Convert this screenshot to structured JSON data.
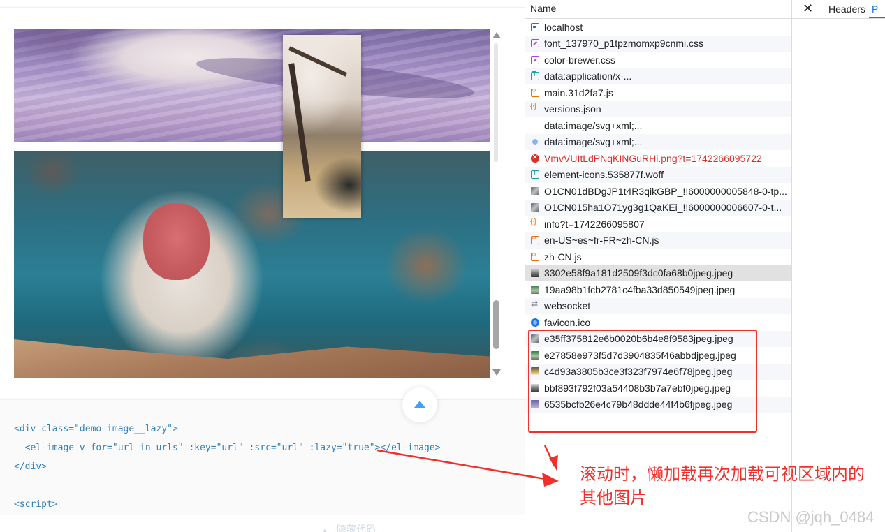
{
  "demo": {
    "code_lines": [
      "<div class=\"demo-image__lazy\">",
      "  <el-image v-for=\"url in urls\" :key=\"url\" :src=\"url\" :lazy=\"true\"></el-image>",
      "</div>",
      "",
      "<script>"
    ],
    "hide_code_label": "隐藏代码"
  },
  "devtools": {
    "name_header": "Name",
    "tabs": {
      "headers": "Headers",
      "preview": "P"
    },
    "requests": [
      {
        "name": "localhost",
        "icon": "document-icon"
      },
      {
        "name": "font_137970_p1tpzmomxp9cnmi.css",
        "icon": "stylesheet-icon"
      },
      {
        "name": "color-brewer.css",
        "icon": "stylesheet-icon"
      },
      {
        "name": "data:application/x-...",
        "icon": "font-icon"
      },
      {
        "name": "main.31d2fa7.js",
        "icon": "script-icon"
      },
      {
        "name": "versions.json",
        "icon": "json-icon"
      },
      {
        "name": "data:image/svg+xml;...",
        "icon": "svg-line-icon"
      },
      {
        "name": "data:image/svg+xml;...",
        "icon": "svg-blue-icon"
      },
      {
        "name": "VmvVUItLdPNqKINGuRHi.png?t=1742266095722",
        "icon": "error-icon",
        "status": "error"
      },
      {
        "name": "element-icons.535877f.woff",
        "icon": "font-icon"
      },
      {
        "name": "O1CN01dBDgJP1t4R3qikGBP_!!6000000005848-0-tp...",
        "icon": "image-icon"
      },
      {
        "name": "O1CN015ha1O71yg3g1QaKEi_!!6000000006607-0-t...",
        "icon": "image-icon"
      },
      {
        "name": "info?t=1742266095807",
        "icon": "json-icon"
      },
      {
        "name": "en-US~es~fr-FR~zh-CN.js",
        "icon": "script-icon"
      },
      {
        "name": "zh-CN.js",
        "icon": "script-icon"
      },
      {
        "name": "3302e58f9a181d2509f3dc0fa68b0jpeg.jpeg",
        "icon": "image-thumb-icon",
        "selected": true
      },
      {
        "name": "19aa98b1fcb2781c4fba33d850549jpeg.jpeg",
        "icon": "image-thumb-icon"
      },
      {
        "name": "websocket",
        "icon": "websocket-icon"
      },
      {
        "name": "favicon.ico",
        "icon": "favicon-icon"
      },
      {
        "name": "e35ff375812e6b0020b6b4e8f9583jpeg.jpeg",
        "icon": "image-thumb-icon"
      },
      {
        "name": "e27858e973f5d7d3904835f46abbdjpeg.jpeg",
        "icon": "image-thumb-icon"
      },
      {
        "name": "c4d93a3805b3ce3f323f7974e6f78jpeg.jpeg",
        "icon": "image-thumb-icon"
      },
      {
        "name": "bbf893f792f03a54408b3b7a7ebf0jpeg.jpeg",
        "icon": "image-thumb-icon"
      },
      {
        "name": "6535bcfb26e4c79b48ddde44f4b6fjpeg.jpeg",
        "icon": "image-thumb-icon"
      }
    ]
  },
  "annotation": {
    "callout": "滚动时，懒加载再次加载可视区域内的其他图片",
    "color": "#f0302a"
  },
  "watermark": "CSDN @jqh_0484"
}
